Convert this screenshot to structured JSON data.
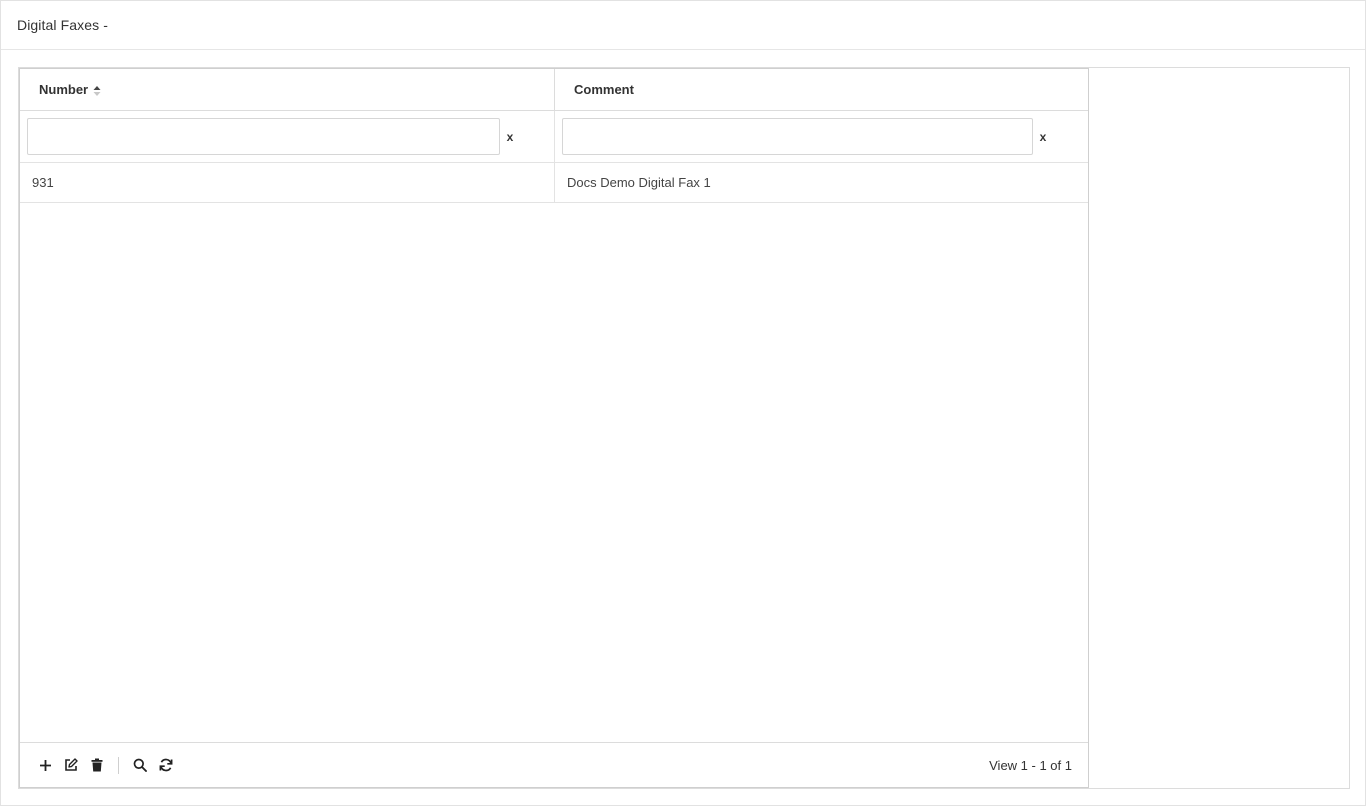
{
  "header": {
    "title": "Digital Faxes -"
  },
  "grid": {
    "columns": [
      {
        "label": "Number",
        "sorted": "asc"
      },
      {
        "label": "Comment"
      }
    ],
    "filters": {
      "number": {
        "value": "",
        "clear_label": "x"
      },
      "comment": {
        "value": "",
        "clear_label": "x"
      }
    },
    "rows": [
      {
        "number": "931",
        "comment": "Docs Demo Digital Fax 1"
      }
    ]
  },
  "footer": {
    "toolbar_icons": [
      "plus-icon",
      "edit-icon",
      "trash-icon",
      "search-icon",
      "refresh-icon"
    ],
    "pager_text": "View 1 - 1 of 1"
  }
}
